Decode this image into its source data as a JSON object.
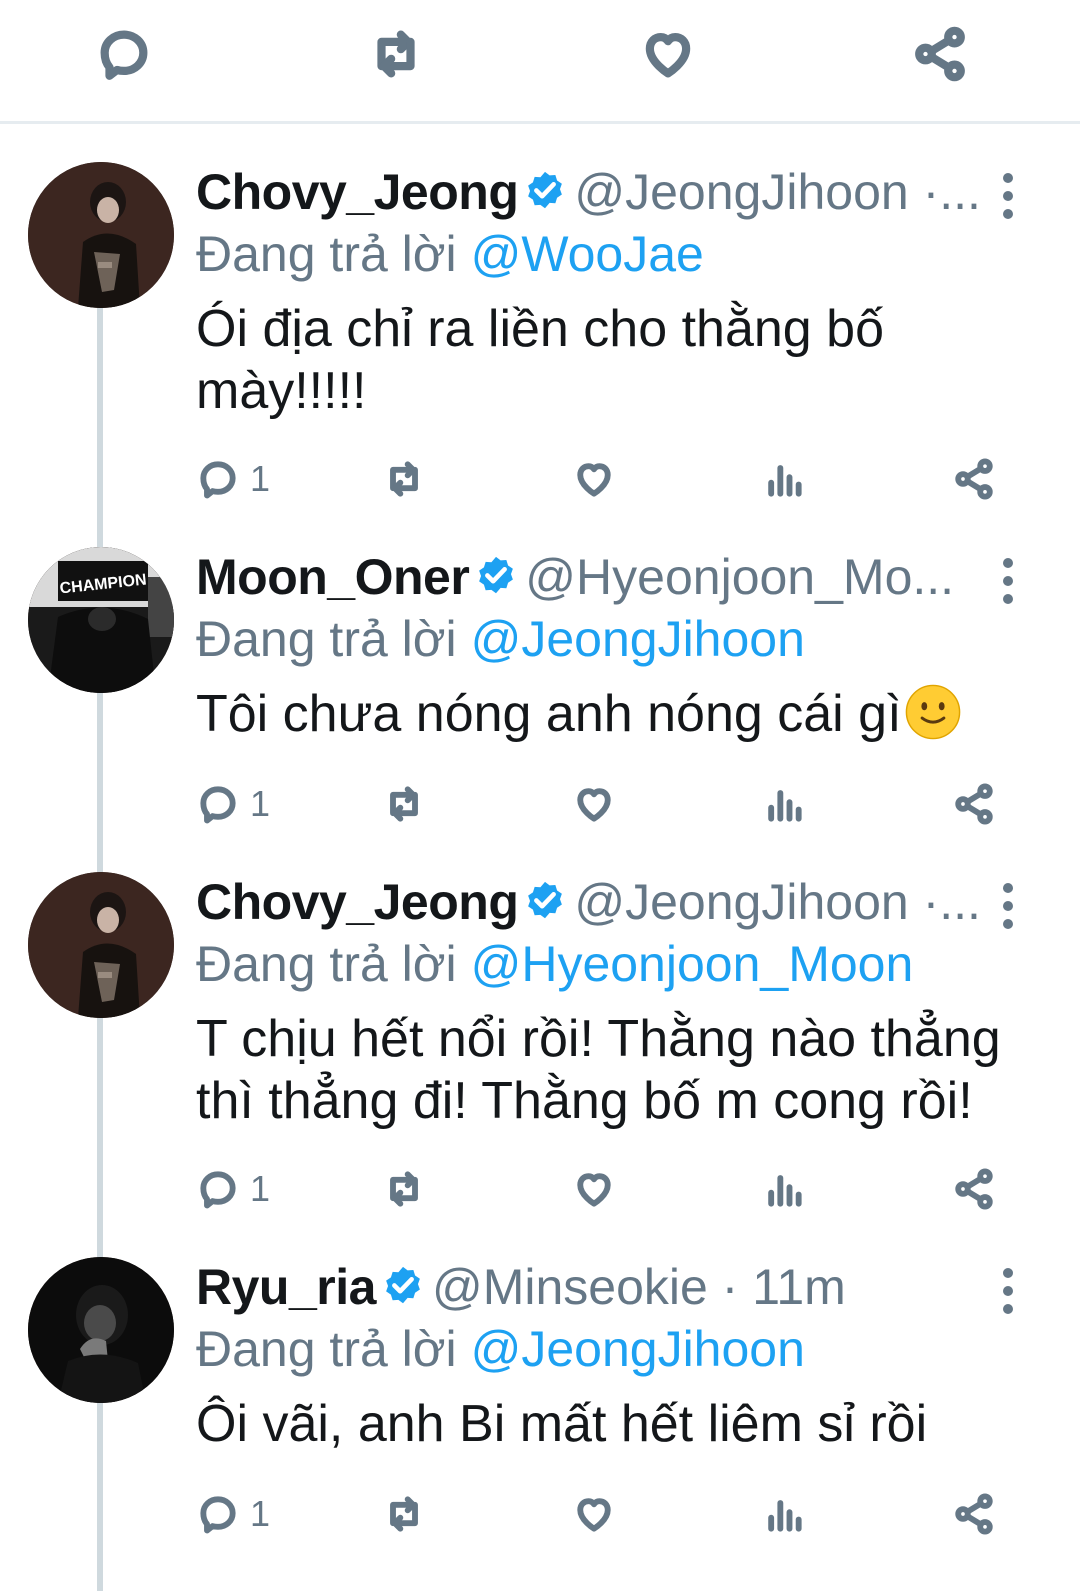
{
  "topbar": {
    "icons": [
      "reply-icon",
      "retweet-icon",
      "like-icon",
      "share-icon"
    ]
  },
  "tweets": [
    {
      "name": "Chovy_Jeong",
      "handle_meta": "@JeongJihoon ·...",
      "replying_prefix": "Đang trả lời",
      "replying_to": "@WooJae",
      "lines": [
        "Ói địa chỉ ra liền cho thằng bố",
        "mày!!!!!"
      ],
      "reply_count": "1"
    },
    {
      "name": "Moon_Oner",
      "handle_meta": "@Hyeonjoon_Mo...",
      "replying_prefix": "Đang trả lời",
      "replying_to": "@JeongJihoon",
      "lines": [
        "Tôi chưa nóng anh nóng cái gì"
      ],
      "emoji": "slightly-smiling-face",
      "reply_count": "1",
      "avatar_text": "CHAMPION"
    },
    {
      "name": "Chovy_Jeong",
      "handle_meta": "@JeongJihoon ·...",
      "replying_prefix": "Đang trả lời",
      "replying_to": "@Hyeonjoon_Moon",
      "lines": [
        "T chịu hết nổi rồi! Thằng nào thẳng",
        "thì thẳng đi! Thằng bố m cong rồi!"
      ],
      "reply_count": "1"
    },
    {
      "name": "Ryu_ria",
      "handle_meta": "@Minseokie · 11m",
      "replying_prefix": "Đang trả lời",
      "replying_to": "@JeongJihoon",
      "lines": [
        "Ôi vãi, anh Bi mất hết liêm sỉ rồi"
      ],
      "reply_count": "1"
    }
  ],
  "colors": {
    "accent": "#1da1f2",
    "muted": "#657786",
    "text": "#14171a",
    "divider": "#e6ecf0"
  }
}
